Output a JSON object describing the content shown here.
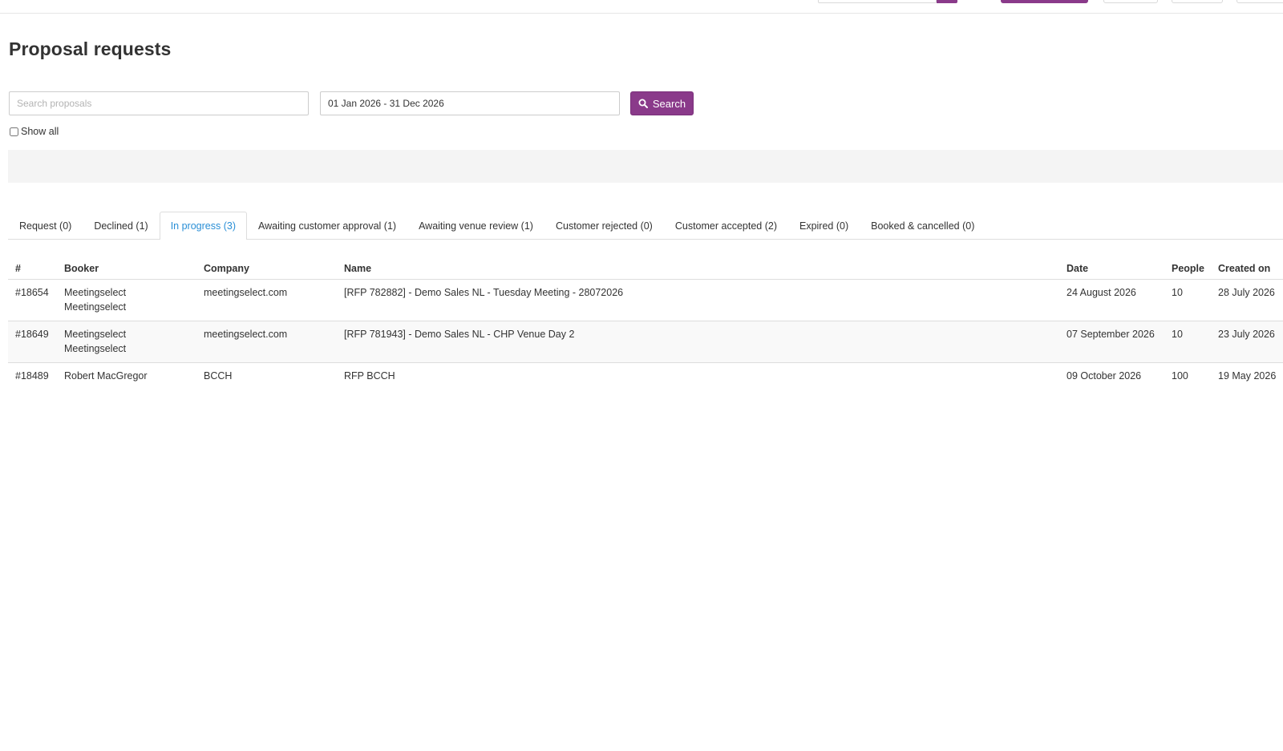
{
  "page": {
    "title": "Proposal requests"
  },
  "filters": {
    "search_placeholder": "Search proposals",
    "date_range": "01 Jan 2026 - 31 Dec 2026",
    "search_label": "Search",
    "show_all_label": "Show all",
    "show_all_checked": false
  },
  "tabs": [
    {
      "label": "Request (0)",
      "active": false
    },
    {
      "label": "Declined (1)",
      "active": false
    },
    {
      "label": "In progress (3)",
      "active": true
    },
    {
      "label": "Awaiting customer approval (1)",
      "active": false
    },
    {
      "label": "Awaiting venue review (1)",
      "active": false
    },
    {
      "label": "Customer rejected (0)",
      "active": false
    },
    {
      "label": "Customer accepted (2)",
      "active": false
    },
    {
      "label": "Expired (0)",
      "active": false
    },
    {
      "label": "Booked & cancelled (0)",
      "active": false
    }
  ],
  "table": {
    "headers": {
      "id": "#",
      "booker": "Booker",
      "company": "Company",
      "name": "Name",
      "date": "Date",
      "people": "People",
      "created": "Created on"
    },
    "rows": [
      {
        "id": "#18654",
        "booker_line1": "Meetingselect",
        "booker_line2": "Meetingselect",
        "company": "meetingselect.com",
        "name": "[RFP 782882] - Demo Sales NL - Tuesday Meeting - 28072026",
        "date": "24 August 2026",
        "people": "10",
        "created": "28 July 2026"
      },
      {
        "id": "#18649",
        "booker_line1": "Meetingselect",
        "booker_line2": "Meetingselect",
        "company": "meetingselect.com",
        "name": "[RFP 781943] - Demo Sales NL - CHP Venue Day 2",
        "date": "07 September 2026",
        "people": "10",
        "created": "23 July 2026"
      },
      {
        "id": "#18489",
        "booker_line1": "Robert MacGregor",
        "booker_line2": "",
        "company": "BCCH",
        "name": "RFP BCCH",
        "date": "09 October 2026",
        "people": "100",
        "created": "19 May 2026"
      }
    ]
  },
  "colors": {
    "primary": "#8a3a8a",
    "active_tab": "#2a8fd6",
    "text": "#333333",
    "border": "#dddddd",
    "grey_bar": "#f4f4f4"
  },
  "icons": {
    "search_button_icon": "search-icon"
  }
}
